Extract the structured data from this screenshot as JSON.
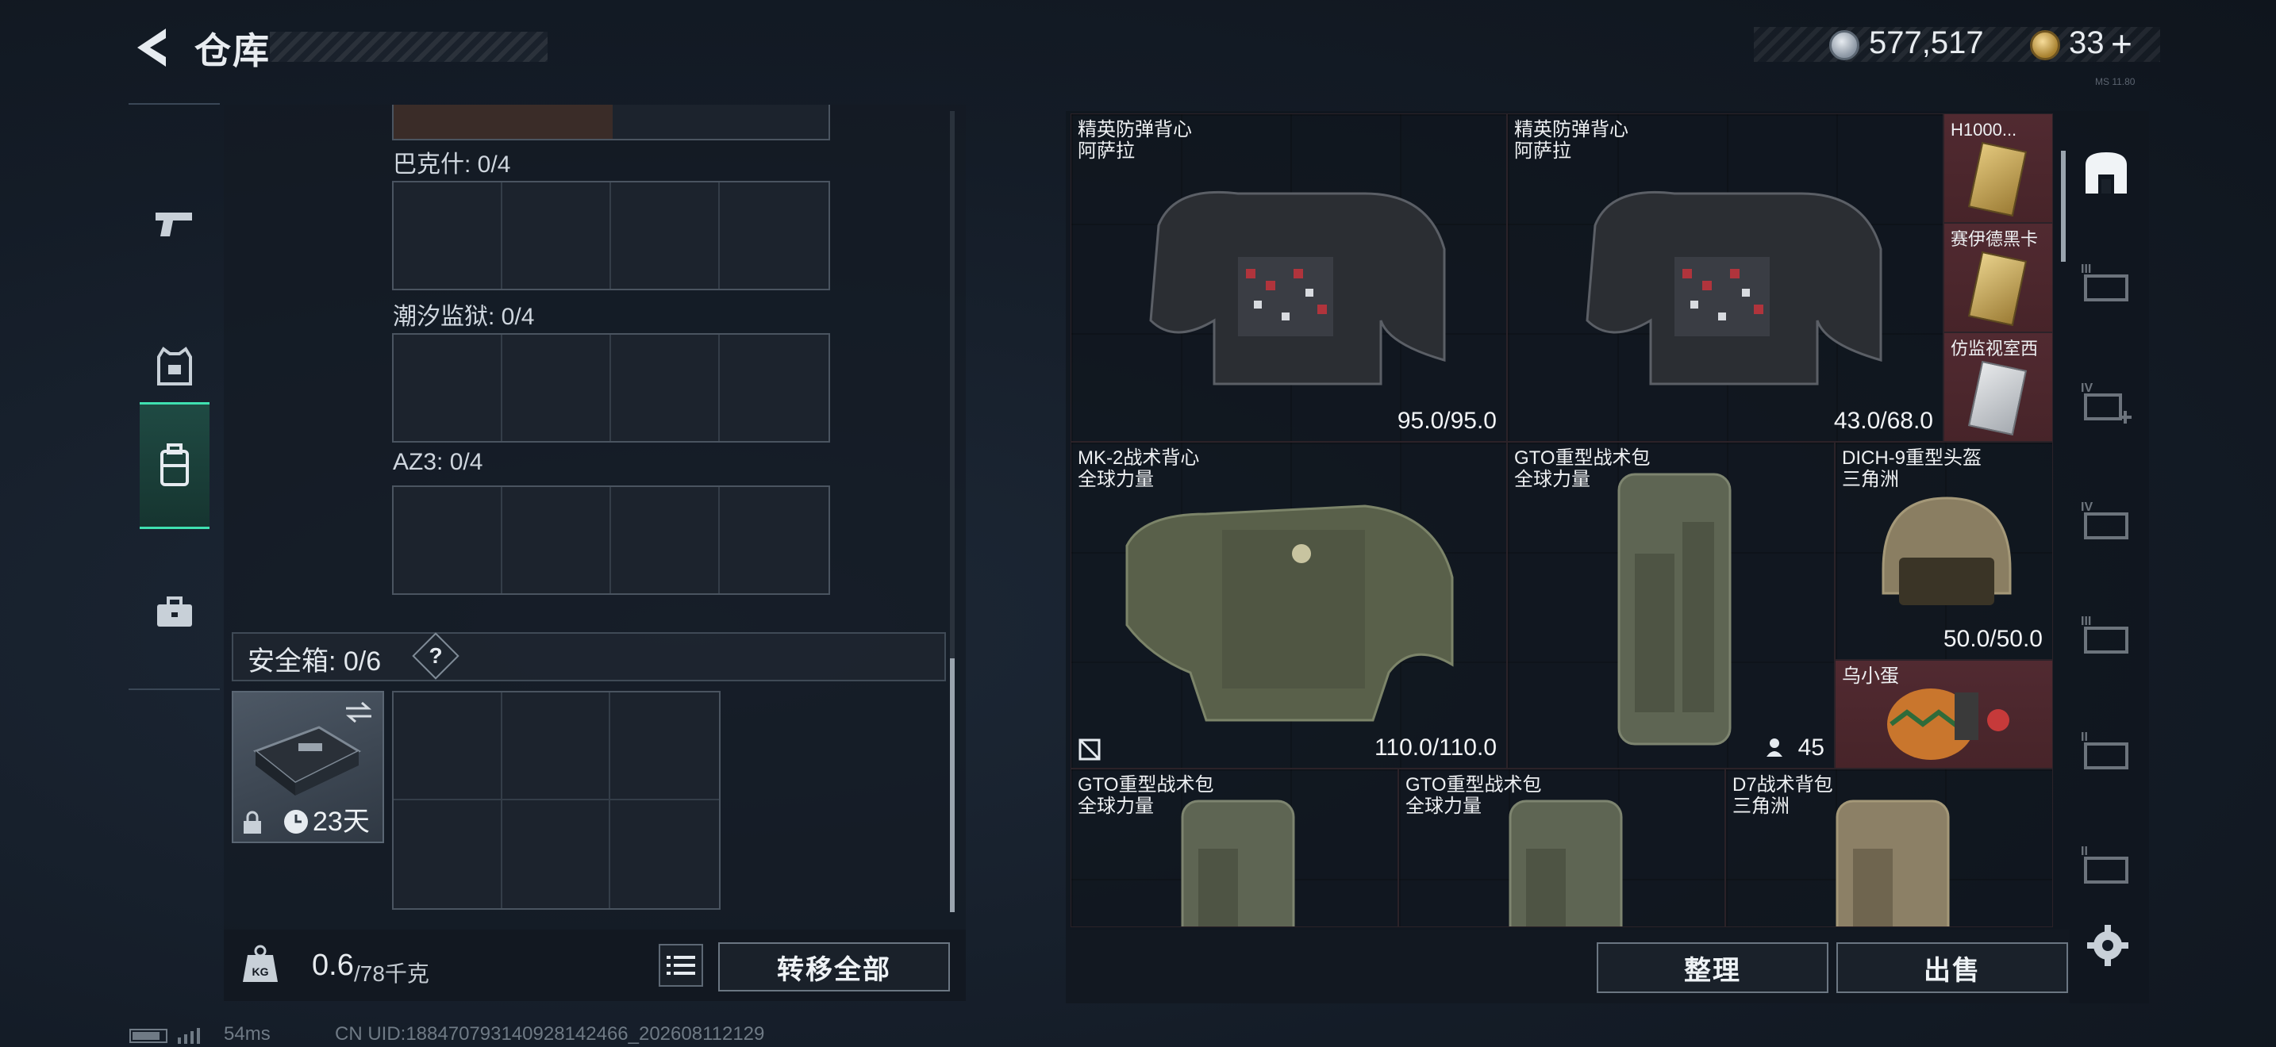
{
  "header": {
    "title": "仓库",
    "silver_amount": "577,517",
    "gold_amount": "33",
    "plus": "+",
    "version_tag": "MS 11.80"
  },
  "containers": [
    {
      "label": "巴克什: 0/4"
    },
    {
      "label": "潮汐监狱: 0/4"
    },
    {
      "label": "AZ3: 0/4"
    }
  ],
  "safebox": {
    "label": "安全箱: 0/6",
    "help": "?",
    "time_left": "23天",
    "swap_icon": "swap-arrows-icon",
    "lock_icon": "lock-icon",
    "clock_icon": "clock-icon"
  },
  "footer": {
    "weight_value": "0.6",
    "weight_capacity": "/78千克",
    "weight_icon_label": "KG",
    "transfer_all": "转移全部",
    "sort": "整理",
    "sell": "出售"
  },
  "items": [
    {
      "name": "精英防弹背心",
      "origin": "阿萨拉",
      "value": "95.0/95.0",
      "rarity": "brown"
    },
    {
      "name": "精英防弹背心",
      "origin": "阿萨拉",
      "value": "43.0/68.0",
      "rarity": "brown"
    },
    {
      "name": "H1000...",
      "origin": "",
      "value": "",
      "rarity": "red"
    },
    {
      "name": "赛伊德黑卡",
      "origin": "",
      "value": "",
      "rarity": "red"
    },
    {
      "name": "仿监视室西",
      "origin": "",
      "value": "",
      "rarity": "red"
    },
    {
      "name": "MK-2战术背心",
      "origin": "全球力量",
      "value": "110.0/110.0",
      "rarity": "purple"
    },
    {
      "name": "GTO重型战术包",
      "origin": "全球力量",
      "value": "45",
      "rarity": "red"
    },
    {
      "name": "DICH-9重型头盔",
      "origin": "三角洲",
      "value": "50.0/50.0",
      "rarity": "red"
    },
    {
      "name": "乌小蛋",
      "origin": "",
      "value": "",
      "rarity": "red"
    },
    {
      "name": "GTO重型战术包",
      "origin": "全球力量",
      "value": "",
      "rarity": "red"
    },
    {
      "name": "GTO重型战术包",
      "origin": "全球力量",
      "value": "",
      "rarity": "red"
    },
    {
      "name": "D7战术背包",
      "origin": "三角洲",
      "value": "",
      "rarity": "red"
    }
  ],
  "right_nav": {
    "tab_labels": [
      "III",
      "IV",
      "IV",
      "III",
      "II",
      "II"
    ]
  },
  "status": {
    "ping": "54ms",
    "uid": "CN UID:18847079314092814​2466_202608112129"
  },
  "colors": {
    "accent": "#3fe0b0",
    "rarity_red": "#512a31",
    "rarity_brown": "#40302a",
    "rarity_purple": "#2c2d45"
  }
}
